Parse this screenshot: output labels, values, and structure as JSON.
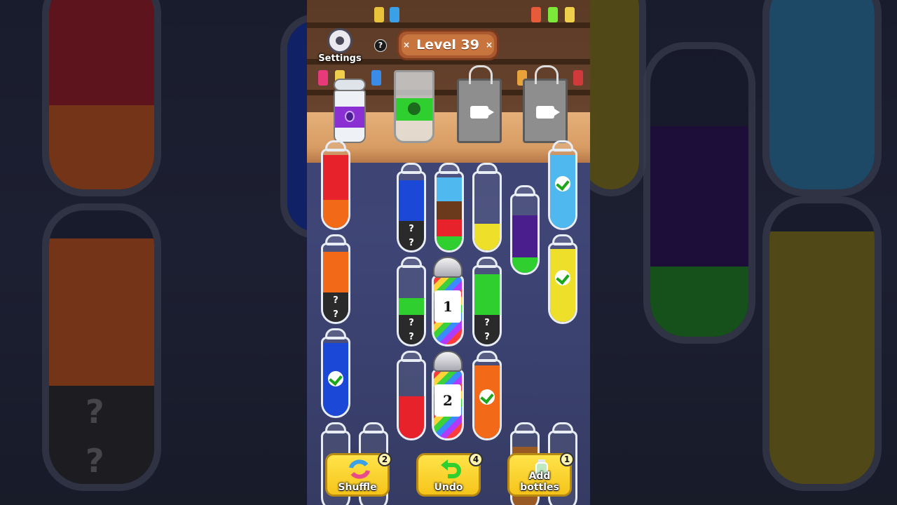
{
  "header": {
    "settings_label": "Settings",
    "help_label": "?",
    "level_label": "Level 39",
    "level_close_glyph": "×"
  },
  "tubes": {
    "question_mark": "?",
    "mystery_1_label": "1",
    "mystery_2_label": "2"
  },
  "actions": [
    {
      "label": "Shuffle",
      "count": "2"
    },
    {
      "label": "Undo",
      "count": "4"
    },
    {
      "label": "Add bottles",
      "count": "1"
    }
  ],
  "colors": {
    "red": "#e8222a",
    "orange": "#f26a18",
    "blue": "#1c48d8",
    "light_blue": "#4fb8ef",
    "yellow": "#eee02a",
    "green": "#2fcf2f",
    "purple": "#4b1e8e",
    "brown": "#6b3a1d",
    "grey": "#2a2a2a"
  }
}
